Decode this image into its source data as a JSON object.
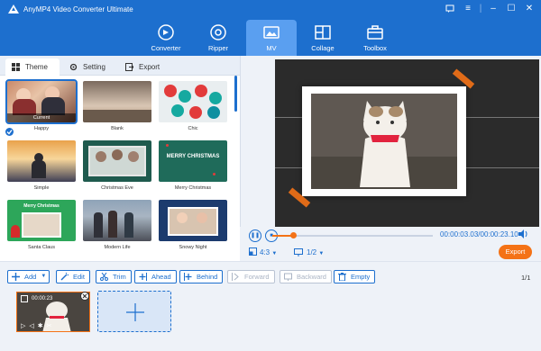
{
  "app": {
    "title": "AnyMP4 Video Converter Ultimate"
  },
  "nav": [
    {
      "label": "Converter",
      "icon": "converter-icon"
    },
    {
      "label": "Ripper",
      "icon": "ripper-icon"
    },
    {
      "label": "MV",
      "icon": "mv-icon",
      "active": true
    },
    {
      "label": "Collage",
      "icon": "collage-icon"
    },
    {
      "label": "Toolbox",
      "icon": "toolbox-icon"
    }
  ],
  "tabs": {
    "theme": "Theme",
    "setting": "Setting",
    "export": "Export"
  },
  "themes": [
    {
      "label": "Happy",
      "badge": "Current",
      "selected": true
    },
    {
      "label": "Blank"
    },
    {
      "label": "Chic"
    },
    {
      "label": "Simple"
    },
    {
      "label": "Christmas Eve"
    },
    {
      "label": "Merry Christmas",
      "overlay": "MERRY CHRISTMAS"
    },
    {
      "label": "Santa Claus",
      "overlay": "Merry Christmas"
    },
    {
      "label": "Modern Life"
    },
    {
      "label": "Snowy Night"
    }
  ],
  "player": {
    "time_current": "00:00:03.03",
    "time_total": "/00:00:23.10",
    "aspect": "4:3",
    "page": "1/2",
    "progress": 0.13,
    "export_label": "Export"
  },
  "toolbar": {
    "add": "Add",
    "edit": "Edit",
    "trim": "Trim",
    "ahead": "Ahead",
    "behind": "Behind",
    "forward": "Forward",
    "backward": "Backward",
    "empty": "Empty",
    "pager": "1/1"
  },
  "clip": {
    "time": "00:00:23"
  },
  "colors": {
    "brand": "#1d6fce",
    "accent": "#f47216"
  }
}
